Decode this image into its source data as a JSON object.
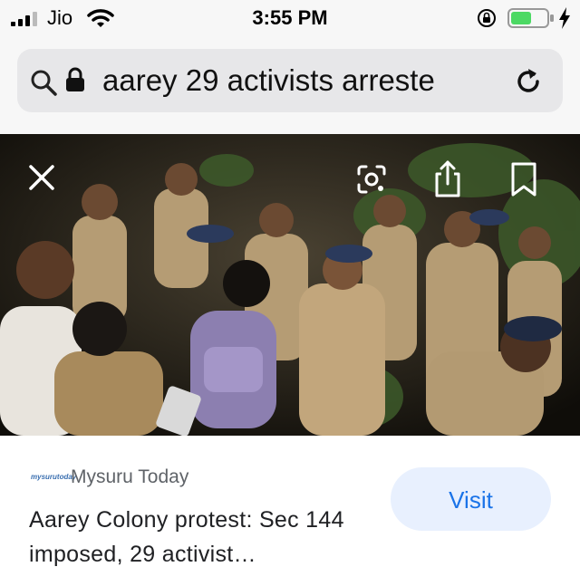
{
  "status_bar": {
    "carrier": "Jio",
    "time": "3:55 PM",
    "battery_color": "#4cd964"
  },
  "url_bar": {
    "query": "aarey 29 activists arreste"
  },
  "image": {
    "description_icons": [
      "close-icon",
      "lens-icon",
      "share-icon",
      "bookmark-icon"
    ]
  },
  "result_card": {
    "source_logo_text": "mysurutoday",
    "source_name": "Mysuru Today",
    "headline": "Aarey Colony protest: Sec 144 imposed, 29 activist…",
    "visit_label": "Visit",
    "accent_color": "#1a73e8"
  }
}
